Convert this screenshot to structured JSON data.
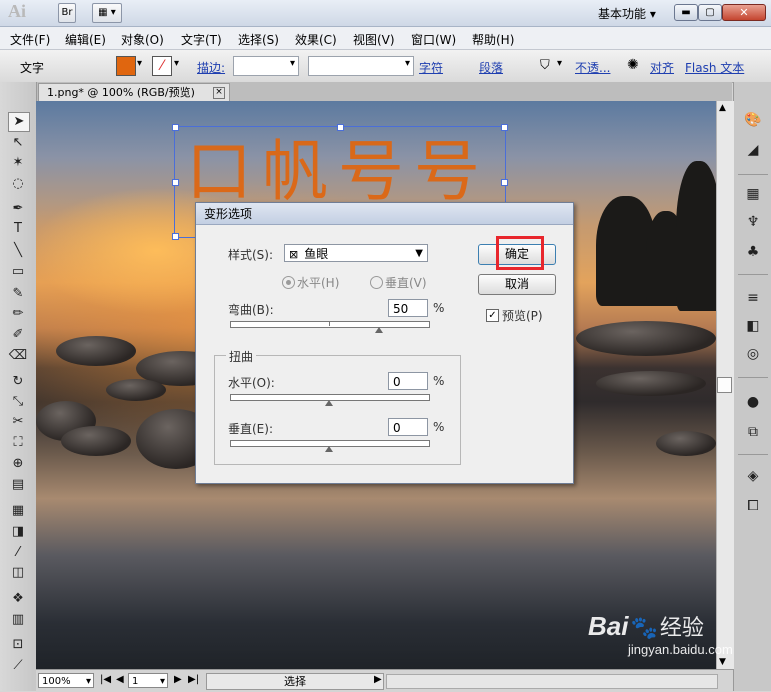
{
  "titlebar": {
    "logo": "Ai",
    "br_label": "Br",
    "workspace": "基本功能"
  },
  "menu": [
    "文件(F)",
    "编辑(E)",
    "对象(O)",
    "文字(T)",
    "选择(S)",
    "效果(C)",
    "视图(V)",
    "窗口(W)",
    "帮助(H)"
  ],
  "controlbar": {
    "tool_name": "文字",
    "stroke_label": "描边:",
    "char_link": "字符",
    "para_link": "段落",
    "opacity_link": "不透...",
    "align_link": "对齐",
    "flash_text_link": "Flash 文本",
    "colors": {
      "fill": "#e0660f"
    }
  },
  "document": {
    "tab_title": "1.png* @ 100% (RGB/预览)",
    "close_glyph": "×"
  },
  "artwork": {
    "text": "口帆号号",
    "color": "#e0660f"
  },
  "dialog": {
    "title": "变形选项",
    "style_label": "样式(S):",
    "style_value": "鱼眼",
    "horizontal_radio": "水平(H)",
    "vertical_radio": "垂直(V)",
    "bend_label": "弯曲(B):",
    "bend_value": "50",
    "percent": "%",
    "distortion_group": "扭曲",
    "dist_h_label": "水平(O):",
    "dist_h_value": "0",
    "dist_v_label": "垂直(E):",
    "dist_v_value": "0",
    "ok_button": "确定",
    "cancel_button": "取消",
    "preview_label": "预览(P)",
    "preview_checked": true,
    "bend_level": 0.75,
    "dist_h_level": 0.5,
    "dist_v_level": 0.5
  },
  "statusbar": {
    "zoom": "100%",
    "artboard": "1",
    "mode": "选择"
  },
  "watermark": {
    "brand": "Bai",
    "brand2": "经验",
    "url": "jingyan.baidu.com"
  },
  "colors": {
    "highlight": "#e8262d",
    "selection": "#4b6ed8"
  }
}
